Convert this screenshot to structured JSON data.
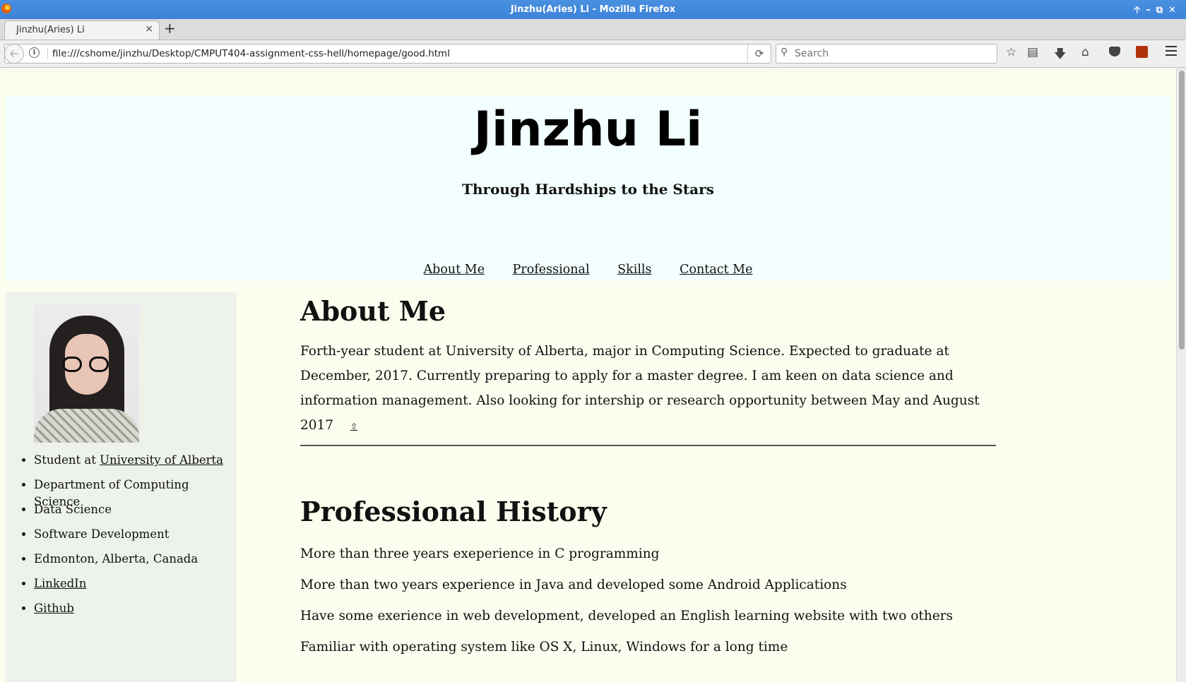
{
  "window": {
    "title": "Jinzhu(Aries) Li - Mozilla Firefox"
  },
  "tab": {
    "label": "Jinzhu(Aries) Li",
    "close": "×",
    "new_tab": "+"
  },
  "navbar": {
    "url": "file:///cshome/jinzhu/Desktop/CMPUT404-assignment-css-hell/homepage/good.html",
    "search_placeholder": "Search"
  },
  "icons": [
    "firefox-logo-icon",
    "back-arrow-icon",
    "info-icon",
    "reload-icon",
    "search-icon",
    "bookmark-star-icon",
    "reading-list-icon",
    "download-icon",
    "home-icon",
    "pocket-icon",
    "extension-icon",
    "hamburger-menu-icon"
  ],
  "header": {
    "name": "Jinzhu Li",
    "tagline": "Through Hardships to the Stars",
    "nav": [
      "About Me",
      "Professional",
      "Skills",
      "Contact Me"
    ]
  },
  "sidebar": {
    "items": [
      {
        "prefix": "Student at ",
        "link": "University of Alberta"
      },
      {
        "prefix": "Department of Computing Science",
        "link": ""
      },
      {
        "prefix": "Data Science",
        "link": ""
      },
      {
        "prefix": "Software Development",
        "link": ""
      },
      {
        "prefix": "Edmonton, Alberta, Canada",
        "link": ""
      },
      {
        "prefix": "",
        "link": "LinkedIn"
      },
      {
        "prefix": "",
        "link": "Github"
      }
    ]
  },
  "about": {
    "title": "About Me",
    "text": "Forth-year student at University of Alberta, major in Computing Science. Expected to graduate at December, 2017. Currently preparing to apply for a master degree. I am keen on data science and information management. Also looking for intership or research opportunity between May and August 2017",
    "top_link": "⇧"
  },
  "professional": {
    "title": "Professional History",
    "items": [
      "More than three years exeperience in C programming",
      "More than two years experience in Java and developed some Android Applications",
      "Have some exerience in web development, developed an English learning website with two others",
      "Familiar with operating system like OS X, Linux, Windows for a long time"
    ]
  }
}
